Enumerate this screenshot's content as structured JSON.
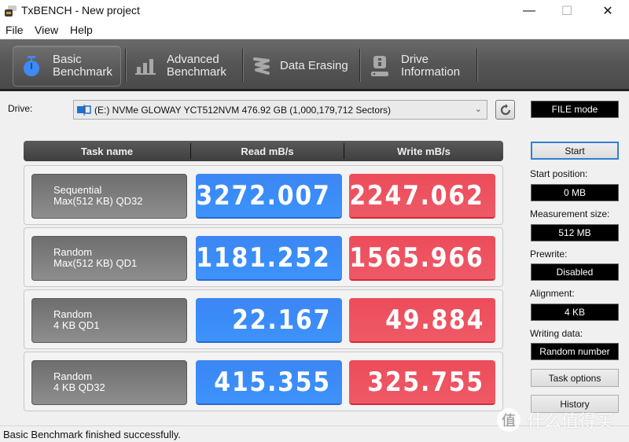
{
  "window": {
    "title": "TxBENCH - New project",
    "controls": {
      "minimize": "—",
      "maximize": "☐",
      "close": "✕"
    }
  },
  "menu": [
    "File",
    "View",
    "Help"
  ],
  "tabs": [
    {
      "line1": "Basic",
      "line2": "Benchmark",
      "icon": "stopwatch-icon",
      "active": true
    },
    {
      "line1": "Advanced",
      "line2": "Benchmark",
      "icon": "bar-chart-icon",
      "active": false
    },
    {
      "line1": "Data Erasing",
      "line2": "",
      "icon": "eraser-icon",
      "active": false
    },
    {
      "line1": "Drive",
      "line2": "Information",
      "icon": "drive-info-icon",
      "active": false
    }
  ],
  "drive": {
    "label": "Drive:",
    "selected": "(E:) NVMe GLOWAY YCT512NVM  476.92 GB (1,000,179,712 Sectors)",
    "mode": "FILE mode"
  },
  "results": {
    "headers": [
      "Task name",
      "Read mB/s",
      "Write mB/s"
    ],
    "rows": [
      {
        "line1": "Sequential",
        "line2": "Max(512 KB) QD32",
        "read": "3272.007",
        "write": "2247.062"
      },
      {
        "line1": "Random",
        "line2": "Max(512 KB) QD1",
        "read": "1181.252",
        "write": "1565.966"
      },
      {
        "line1": "Random",
        "line2": "4 KB QD1",
        "read": "22.167",
        "write": "49.884"
      },
      {
        "line1": "Random",
        "line2": "4 KB QD32",
        "read": "415.355",
        "write": "325.755"
      }
    ]
  },
  "panel": {
    "start": "Start",
    "start_position_label": "Start position:",
    "start_position": "0 MB",
    "measurement_size_label": "Measurement size:",
    "measurement_size": "512 MB",
    "prewrite_label": "Prewrite:",
    "prewrite": "Disabled",
    "alignment_label": "Alignment:",
    "alignment": "4 KB",
    "writing_data_label": "Writing data:",
    "writing_data": "Random number",
    "task_options": "Task options",
    "history": "History"
  },
  "status": "Basic Benchmark finished successfully.",
  "watermark": {
    "badge": "值",
    "text": "什么值得买"
  },
  "colors": {
    "read": "#3a8cf8",
    "write": "#ee5462",
    "accent": "#2f7fd6"
  }
}
